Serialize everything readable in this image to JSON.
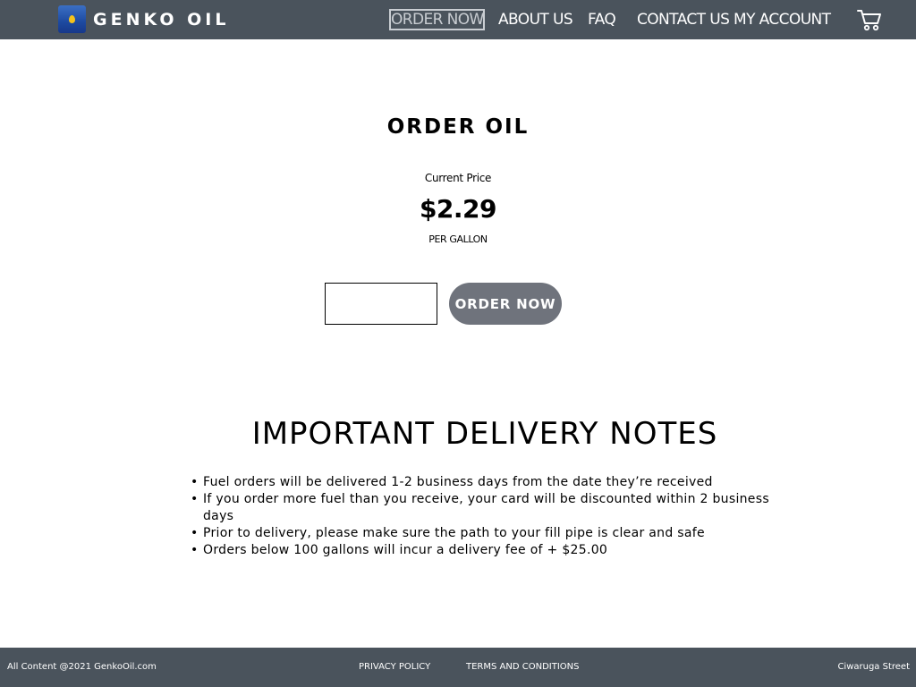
{
  "header": {
    "logo_text": "GENKO OIL",
    "logo_icon": "oil-barrel-icon",
    "nav": [
      {
        "label": "ORDER NOW"
      },
      {
        "label": "ABOUT US"
      },
      {
        "label": "FAQ"
      },
      {
        "label": "CONTACT US"
      },
      {
        "label": "MY ACCOUNT"
      }
    ],
    "cart_icon": "cart-icon"
  },
  "main": {
    "title": "ORDER OIL",
    "price_label": "Current Price",
    "price_value": "$2.29",
    "price_unit": "PER GALLON",
    "quantity_input": {
      "value": "",
      "placeholder": ""
    },
    "order_button": "ORDER NOW"
  },
  "notes": {
    "title": "IMPORTANT DELIVERY NOTES",
    "items": [
      "Fuel orders will be delivered 1-2 business days from the date they’re received",
      "If you order more fuel than you receive, your card will be discounted within 2 business days",
      "Prior to delivery, please make sure the path to your fill pipe is clear and safe",
      "Orders below 100 gallons will incur a delivery fee of + $25.00"
    ]
  },
  "footer": {
    "copyright": "All Content @2021 GenkoOil.com",
    "privacy": "PRIVACY POLICY",
    "terms": "TERMS AND CONDITIONS",
    "address": "Ciwaruga Street"
  },
  "colors": {
    "header_bg": "#4a535c",
    "button_bg": "#6f737c",
    "logo_blue": "#1d4aa0",
    "logo_drop": "#f4c21c"
  }
}
